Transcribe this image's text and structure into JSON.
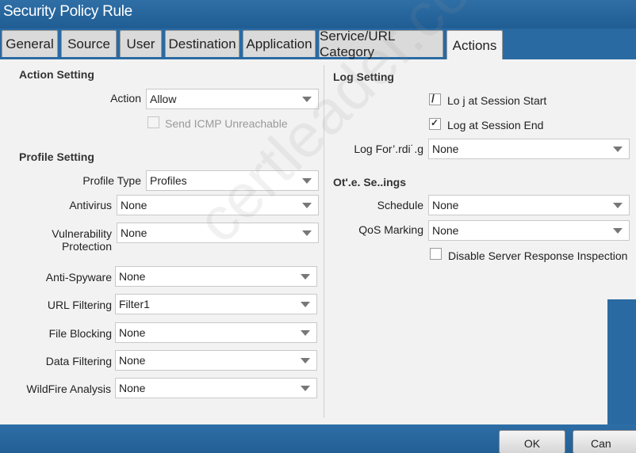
{
  "window": {
    "title": "Security Policy Rule"
  },
  "tabs": [
    {
      "label": "General"
    },
    {
      "label": "Source"
    },
    {
      "label": "User"
    },
    {
      "label": "Destination"
    },
    {
      "label": "Application"
    },
    {
      "label": "Service/URL Category"
    },
    {
      "label": "Actions"
    }
  ],
  "action_setting": {
    "heading": "Action Setting",
    "action_label": "Action",
    "action_value": "Allow",
    "send_icmp_label": "Send ICMP Unreachable"
  },
  "profile_setting": {
    "heading": "Profile Setting",
    "rows": [
      {
        "label": "Profile Type",
        "value": "Profiles"
      },
      {
        "label": "Antivirus",
        "value": "None"
      },
      {
        "label": "Vulnerability",
        "label2": "Protection",
        "value": "None"
      },
      {
        "label": "Anti-Spyware",
        "value": "None"
      },
      {
        "label": "URL Filtering",
        "value": "Filter1"
      },
      {
        "label": "File Blocking",
        "value": "None"
      },
      {
        "label": "Data Filtering",
        "value": "None"
      },
      {
        "label": "WildFire Analysis",
        "value": "None"
      }
    ]
  },
  "log_setting": {
    "heading": "Log Setting",
    "log_start_label": "Lo j at Session Start",
    "log_start_mark": "/",
    "log_end_label": "Log at Session End",
    "log_end_mark": "✓",
    "forwarding_label": "Log For’.rdi˙.g",
    "forwarding_value": "None"
  },
  "other_settings": {
    "heading": "Ot'.e. Se..ings",
    "schedule_label": "Schedule",
    "schedule_value": "None",
    "qos_label": "QoS Marking",
    "qos_value": "None",
    "disable_inspection_label": "Disable Server Response Inspection"
  },
  "footer": {
    "ok_label": "OK",
    "cancel_label": "Can"
  },
  "watermark": "certleader.com",
  "colors": {
    "accent": "#2a6aa3",
    "panel": "#f2f2f2"
  }
}
